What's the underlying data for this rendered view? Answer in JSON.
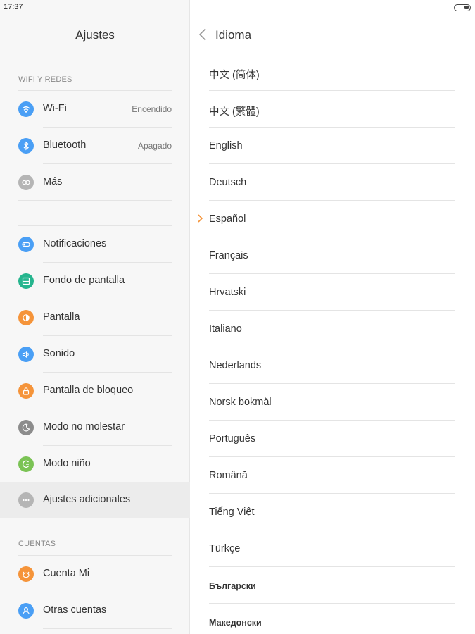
{
  "status_bar": {
    "time": "17:37"
  },
  "left_panel": {
    "title": "Ajustes",
    "sections": {
      "wifi_label": "WIFI Y REDES",
      "accounts_label": "CUENTAS"
    },
    "items": [
      {
        "label": "Wi-Fi",
        "value": "Encendido",
        "icon": "wifi-icon",
        "color": "#4a9ff5"
      },
      {
        "label": "Bluetooth",
        "value": "Apagado",
        "icon": "bluetooth-icon",
        "color": "#4a9ff5"
      },
      {
        "label": "Más",
        "value": "",
        "icon": "more-connections-icon",
        "color": "#b5b5b5"
      },
      {
        "label": "Notificaciones",
        "value": "",
        "icon": "notifications-icon",
        "color": "#4a9ff5"
      },
      {
        "label": "Fondo de pantalla",
        "value": "",
        "icon": "wallpaper-icon",
        "color": "#26b58e"
      },
      {
        "label": "Pantalla",
        "value": "",
        "icon": "display-icon",
        "color": "#f5943a"
      },
      {
        "label": "Sonido",
        "value": "",
        "icon": "sound-icon",
        "color": "#4a9ff5"
      },
      {
        "label": "Pantalla de bloqueo",
        "value": "",
        "icon": "lock-icon",
        "color": "#f5943a"
      },
      {
        "label": "Modo no molestar",
        "value": "",
        "icon": "moon-icon",
        "color": "#8c8c8c"
      },
      {
        "label": "Modo niño",
        "value": "",
        "icon": "child-mode-icon",
        "color": "#7bc355"
      },
      {
        "label": "Ajustes adicionales",
        "value": "",
        "icon": "more-dots-icon",
        "color": "#b5b5b5"
      },
      {
        "label": "Cuenta Mi",
        "value": "",
        "icon": "mi-account-icon",
        "color": "#f5943a"
      },
      {
        "label": "Otras cuentas",
        "value": "",
        "icon": "user-icon",
        "color": "#4a9ff5"
      }
    ]
  },
  "right_panel": {
    "title": "Idioma",
    "selected": "Español",
    "languages": [
      "中文 (简体)",
      "中文 (繁體)",
      "English",
      "Deutsch",
      "Español",
      "Français",
      "Hrvatski",
      "Italiano",
      "Nederlands",
      "Norsk bokmål",
      "Português",
      "Română",
      "Tiếng Việt",
      "Türkçe",
      "Български",
      "Македонски"
    ]
  },
  "colors": {
    "accent_orange": "#f5943a",
    "accent_blue": "#4a9ff5",
    "panel_bg": "#f7f7f7"
  }
}
